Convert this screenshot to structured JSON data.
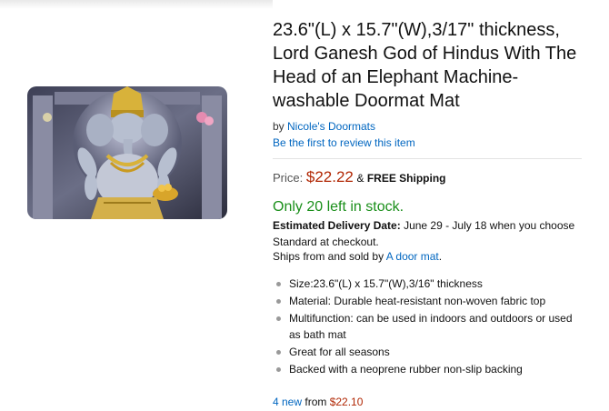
{
  "top_faded_text": "",
  "product": {
    "title": "23.6\"(L) x 15.7\"(W),3/17\" thickness, Lord Ganesh God of Hindus With The Head of an Elephant Machine-washable Doormat Mat",
    "by_prefix": "by ",
    "brand": "Nicole's Doormats",
    "review_link": "Be the first to review this item",
    "price_label": "Price:",
    "price": "$22.22",
    "shipping_prefix": "& ",
    "shipping": "FREE Shipping",
    "stock": "Only 20 left in stock.",
    "delivery_label": "Estimated Delivery Date:",
    "delivery_text": " June 29 - July 18 when you choose Standard at checkout.",
    "ships_prefix": "Ships from and sold by ",
    "seller": "A door mat",
    "ships_suffix": ".",
    "bullets": [
      "Size:23.6\"(L) x 15.7\"(W),3/16\" thickness",
      "Material: Durable heat-resistant non-woven fabric top",
      "Multifunction: can be used in indoors and outdoors or used as bath mat",
      "Great for all seasons",
      "Backed with a neoprene rubber non-slip backing"
    ],
    "offers_count": "4 new",
    "offers_from": " from ",
    "offers_price": "$22.10"
  },
  "colors": {
    "link": "#0066c0",
    "price": "#b12704",
    "stock": "#1a8f1a"
  }
}
